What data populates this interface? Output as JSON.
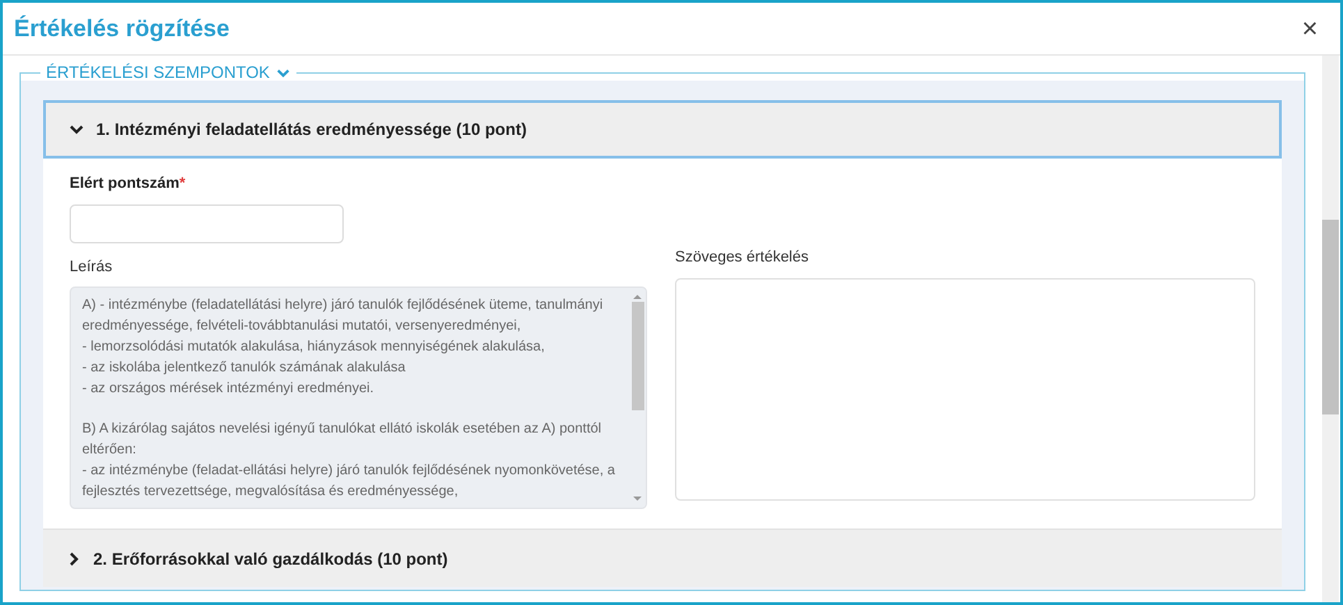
{
  "window": {
    "title": "Értékelés rögzítése",
    "close": "×"
  },
  "fieldset": {
    "legend": "ÉRTÉKELÉSI SZEMPONTOK",
    "expanded": true
  },
  "criteria": [
    {
      "title": "1. Intézményi feladatellátás eredményessége (10 pont)",
      "expanded": true,
      "focused": true,
      "score_label": "Elért pontszám",
      "required": "*",
      "description_label": "Leírás",
      "description_paragraphs": [
        {
          "lines": [
            "A) - intézménybe (feladatellátási helyre) járó tanulók fejlődésének üteme, tanulmányi",
            "eredményessége, felvételi-továbbtanulási mutatói, versenyeredményei,",
            "- lemorzsolódási mutatók alakulása, hiányzások mennyiségének alakulása,",
            "- az iskolába jelentkező tanulók számának alakulása",
            "- az országos mérések intézményi eredményei."
          ]
        },
        {
          "lines": [
            "B) A kizárólag sajátos nevelési igényű tanulókat ellátó iskolák esetében az A) ponttól",
            "eltérően:",
            "- az intézménybe (feladat-ellátási helyre) járó tanulók fejlődésének nyomonkövetése, a",
            "fejlesztés tervezettsége, megvalósítása és eredményessége,"
          ]
        }
      ],
      "evaluation_label": "Szöveges értékelés"
    },
    {
      "title": "2. Erőforrásokkal való gazdálkodás (10 pont)",
      "expanded": false,
      "focused": false
    }
  ]
}
